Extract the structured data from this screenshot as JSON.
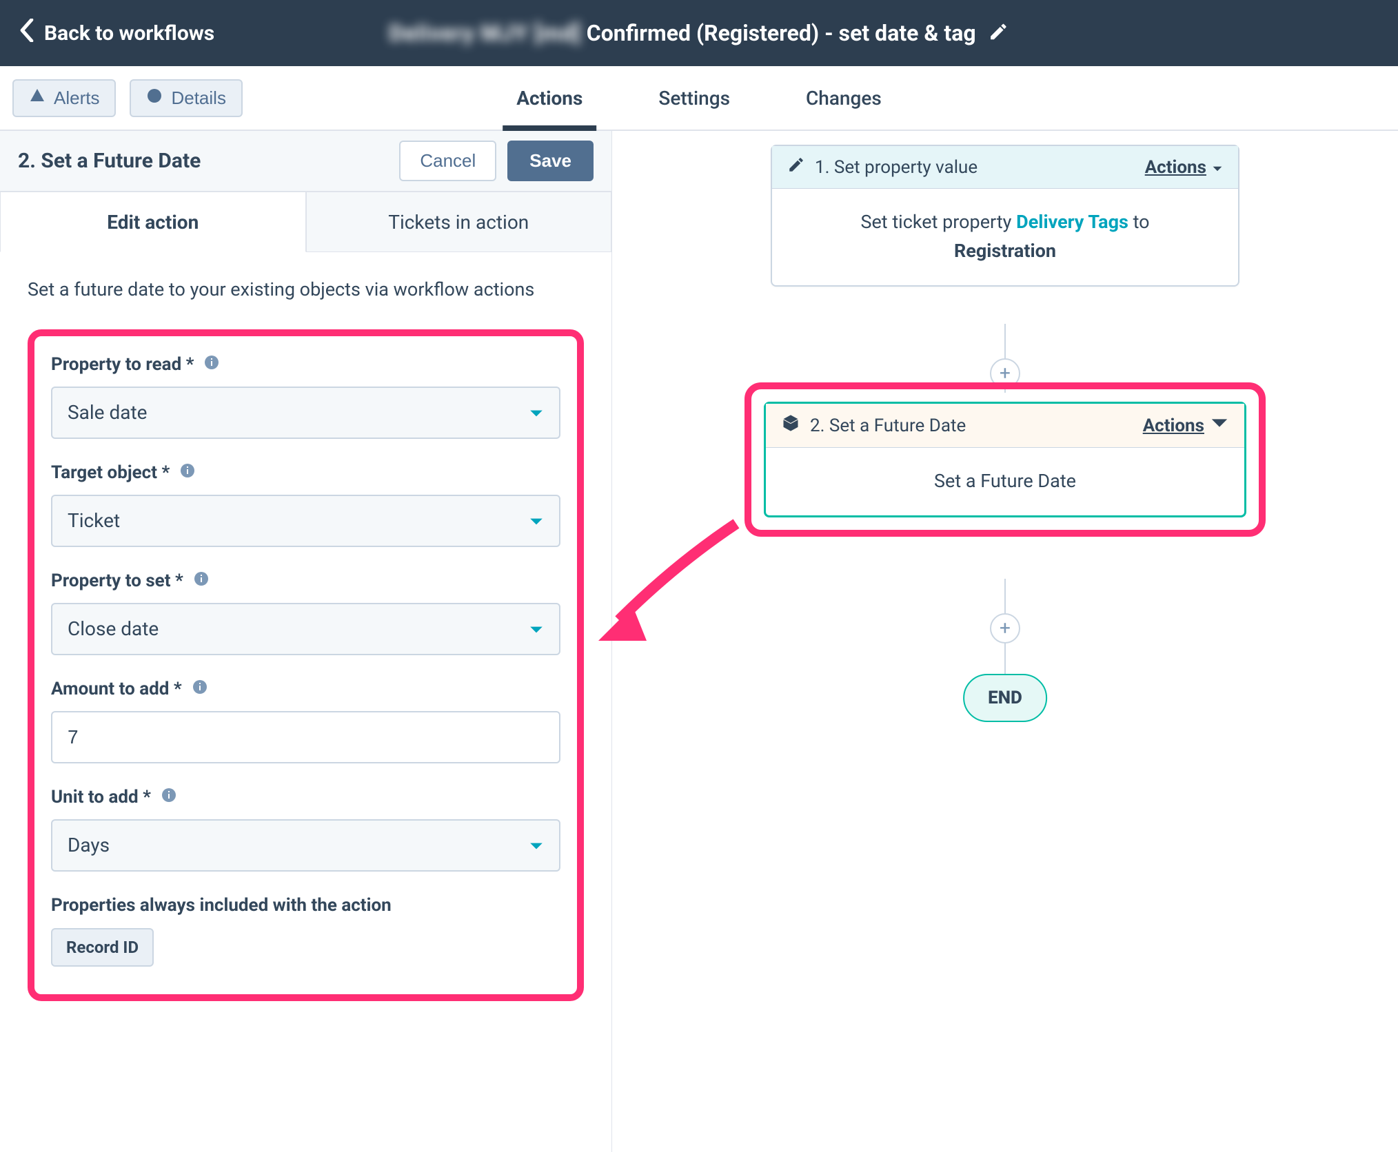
{
  "header": {
    "back_label": "Back to workflows",
    "workflow_title_hidden": "Delivery MJY [md]",
    "workflow_title_visible": "Confirmed (Registered) - set date & tag"
  },
  "subheader": {
    "alerts_label": "Alerts",
    "details_label": "Details",
    "tabs": {
      "actions": "Actions",
      "settings": "Settings",
      "changes": "Changes"
    }
  },
  "panel": {
    "title": "2. Set a Future Date",
    "cancel_label": "Cancel",
    "save_label": "Save",
    "tabs": {
      "edit": "Edit action",
      "tickets": "Tickets in action"
    },
    "description": "Set a future date to your existing objects via workflow actions",
    "fields": {
      "property_to_read": {
        "label": "Property to read *",
        "value": "Sale date"
      },
      "target_object": {
        "label": "Target object *",
        "value": "Ticket"
      },
      "property_to_set": {
        "label": "Property to set *",
        "value": "Close date"
      },
      "amount_to_add": {
        "label": "Amount to add *",
        "value": "7"
      },
      "unit_to_add": {
        "label": "Unit to add *",
        "value": "Days"
      }
    },
    "included": {
      "label": "Properties always included with the action",
      "pills": [
        "Record ID"
      ]
    }
  },
  "canvas": {
    "node1": {
      "step_label": "1. Set property value",
      "actions_label": "Actions",
      "body_prefix": "Set ticket property",
      "body_link": "Delivery Tags",
      "body_mid": "to",
      "body_bold": "Registration"
    },
    "node2": {
      "step_label": "2. Set a Future Date",
      "actions_label": "Actions",
      "body": "Set a Future Date"
    },
    "end_label": "END"
  }
}
